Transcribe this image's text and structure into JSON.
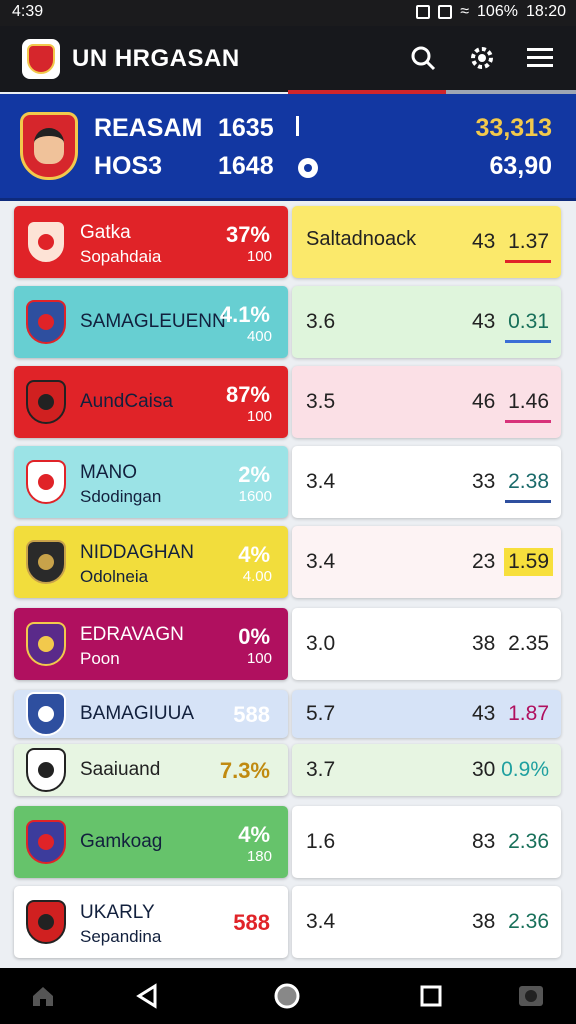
{
  "status": {
    "time": "4:39",
    "battery": "106%",
    "clock": "18:20"
  },
  "header": {
    "title": "UN HRGASAN"
  },
  "hero": {
    "name1": "REASAM",
    "num1": "1635",
    "sep": "|",
    "right1": "33,313",
    "name2": "HOS3",
    "num2": "1648",
    "right2": "63,90"
  },
  "rows": [
    {
      "name": "Gatka",
      "sub": "Sopahdaia",
      "pct": "37%",
      "pct_sub": "100",
      "label": "Saltadnoack",
      "num": "",
      "right_num": "43",
      "odds": "1.37",
      "bg": "#e02328",
      "text": "#ffffff",
      "rbg": "#fbe96b",
      "odds_color": "#222",
      "odds_bg": "",
      "uline": "#e02328",
      "crest": "#fde3d6",
      "crest_dot": "#e02328"
    },
    {
      "name": "SAMAGLEUENN",
      "sub": "",
      "pct": "4.1%",
      "pct_sub": "400",
      "label": "",
      "num": "3.6",
      "right_num": "43",
      "odds": "0.31",
      "bg": "#67cfd2",
      "text": "#12203d",
      "rbg": "#dff5dc",
      "odds_color": "#18705a",
      "odds_bg": "",
      "uline": "#3b6ed6",
      "crest": "#2e4f9f",
      "crest_dot": "#e02328"
    },
    {
      "name": "AundCaisa",
      "sub": "",
      "pct": "87%",
      "pct_sub": "100",
      "label": "",
      "num": "3.5",
      "right_num": "46",
      "odds": "1.46",
      "bg": "#e02328",
      "text": "#12203d",
      "rbg": "#fbe0e6",
      "odds_color": "#222",
      "odds_bg": "",
      "uline": "#d8327a",
      "crest": "#d02020",
      "crest_dot": "#222222"
    },
    {
      "name": "MANO",
      "sub": "Sdodingan",
      "pct": "2%",
      "pct_sub": "1600",
      "label": "",
      "num": "3.4",
      "right_num": "33",
      "odds": "2.38",
      "bg": "#9be3e6",
      "text": "#12203d",
      "rbg": "#ffffff",
      "odds_color": "#1a6a6a",
      "odds_bg": "",
      "uline": "#2e4f9f",
      "crest": "#ffffff",
      "crest_dot": "#e02328"
    },
    {
      "name": "NIDDAGHAN",
      "sub": "Odolneia",
      "pct": "4%",
      "pct_sub": "4.00",
      "label": "",
      "num": "3.4",
      "right_num": "23",
      "odds": "1.59",
      "bg": "#f2dd3c",
      "text": "#12203d",
      "rbg": "#fdf3f4",
      "odds_color": "#222",
      "odds_bg": "#f7df3c",
      "uline": "",
      "crest": "#2a2a2a",
      "crest_dot": "#c8a24a"
    },
    {
      "name": "EDRAVAGN",
      "sub": "Poon",
      "pct": "0%",
      "pct_sub": "100",
      "label": "",
      "num": "3.0",
      "right_num": "38",
      "odds": "2.35",
      "bg": "#b0105f",
      "text": "#ffffff",
      "rbg": "#ffffff",
      "odds_color": "#222",
      "odds_bg": "",
      "uline": "",
      "crest": "#5a2a8a",
      "crest_dot": "#f2c94c"
    },
    {
      "name": "BAMAGIUUA",
      "sub": "",
      "pct": "588",
      "pct_sub": "",
      "label": "",
      "num": "5.7",
      "right_num": "43",
      "odds": "1.87",
      "bg": "#d6e3f7",
      "text": "#12203d",
      "rbg": "#d6e3f7",
      "odds_color": "#b0105f",
      "odds_bg": "",
      "uline": "",
      "crest": "#2e4f9f",
      "crest_dot": "#ffffff"
    },
    {
      "name": "Saaiuand",
      "sub": "",
      "pct": "7.3%",
      "pct_sub": "",
      "label": "",
      "num": "3.7",
      "right_num": "30",
      "odds": "0.9%",
      "bg": "#e7f5e2",
      "text": "#222222",
      "rbg": "#e7f5e2",
      "odds_color": "#20a0a0",
      "odds_bg": "",
      "uline": "",
      "crest": "#ffffff",
      "crest_dot": "#222222"
    },
    {
      "name": "Gamkoag",
      "sub": "",
      "pct": "4%",
      "pct_sub": "180",
      "label": "",
      "num": "1.6",
      "right_num": "83",
      "odds": "2.36",
      "bg": "#66c36b",
      "text": "#12203d",
      "rbg": "#ffffff",
      "odds_color": "#18705a",
      "odds_bg": "",
      "uline": "",
      "crest": "#3c3c9c",
      "crest_dot": "#e02328"
    },
    {
      "name": "UKARLY",
      "sub": "Sepandina",
      "pct": "588",
      "pct_sub": "",
      "label": "",
      "num": "3.4",
      "right_num": "38",
      "odds": "2.36",
      "bg": "#ffffff",
      "text": "#12203d",
      "rbg": "#ffffff",
      "odds_color": "#18705a",
      "odds_bg": "",
      "uline": "",
      "crest": "#d02020",
      "crest_dot": "#222222"
    }
  ],
  "nav": {
    "icons": [
      "home-icon",
      "back-icon",
      "home-circle-icon",
      "recents-icon",
      "camera-icon"
    ]
  }
}
